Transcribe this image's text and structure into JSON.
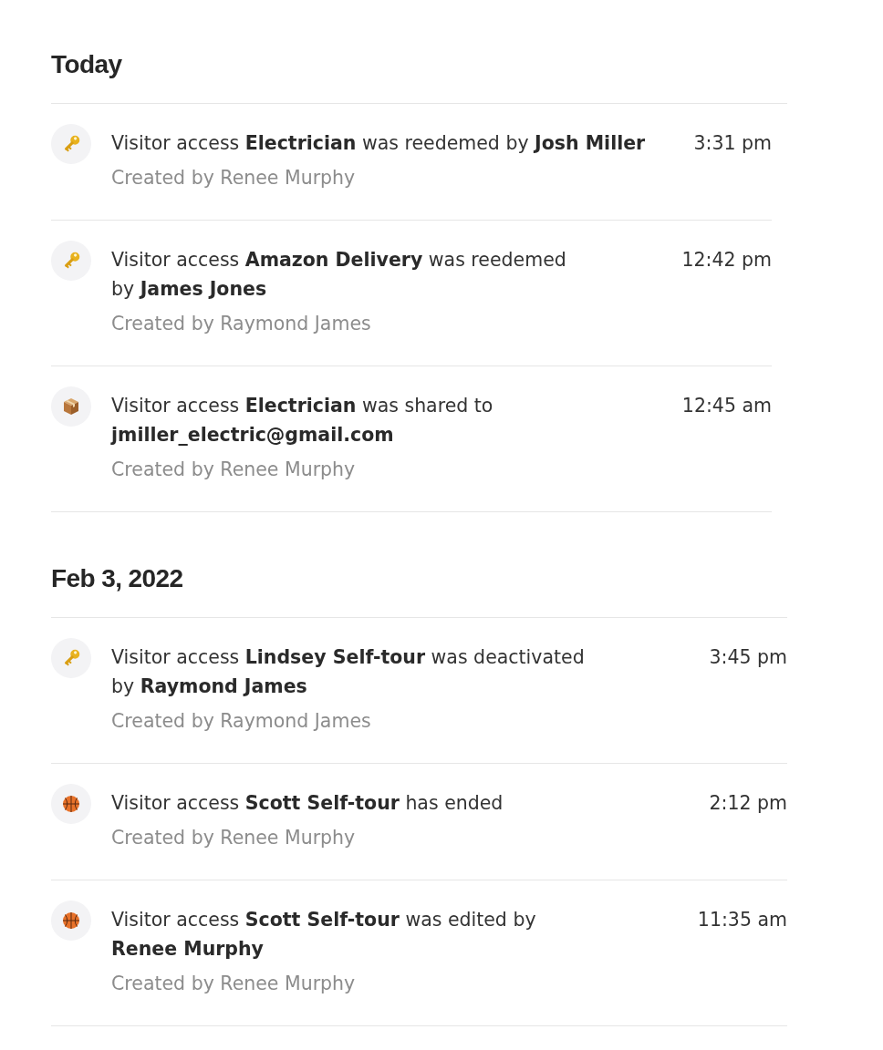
{
  "sections": [
    {
      "heading": "Today",
      "events": [
        {
          "kind": "key",
          "message": "Visitor access **Electrician** was reedemed by **Josh Miller**",
          "created_by": "Created by Renee Murphy",
          "time": "3:31 pm"
        },
        {
          "kind": "key",
          "message": "Visitor access **Amazon Delivery** was reedemed\nby **James Jones**",
          "created_by": "Created by Raymond James",
          "time": "12:42 pm"
        },
        {
          "kind": "package",
          "message": "Visitor access **Electrician** was shared to\n**jmiller_electric@gmail.com**",
          "created_by": "Created by Renee Murphy",
          "time": "12:45 am"
        }
      ]
    },
    {
      "heading": "Feb 3, 2022",
      "events": [
        {
          "kind": "key",
          "message": "Visitor access **Lindsey Self-tour** was deactivated\nby **Raymond James**",
          "created_by": "Created by Raymond James",
          "time": "3:45 pm"
        },
        {
          "kind": "ball",
          "message": "Visitor access **Scott Self-tour** has ended",
          "created_by": "Created by Renee Murphy",
          "time": "2:12 pm"
        },
        {
          "kind": "ball",
          "message": "Visitor access **Scott Self-tour** was edited by\n**Renee Murphy**",
          "created_by": "Created by Renee Murphy",
          "time": "11:35 am"
        }
      ]
    }
  ]
}
